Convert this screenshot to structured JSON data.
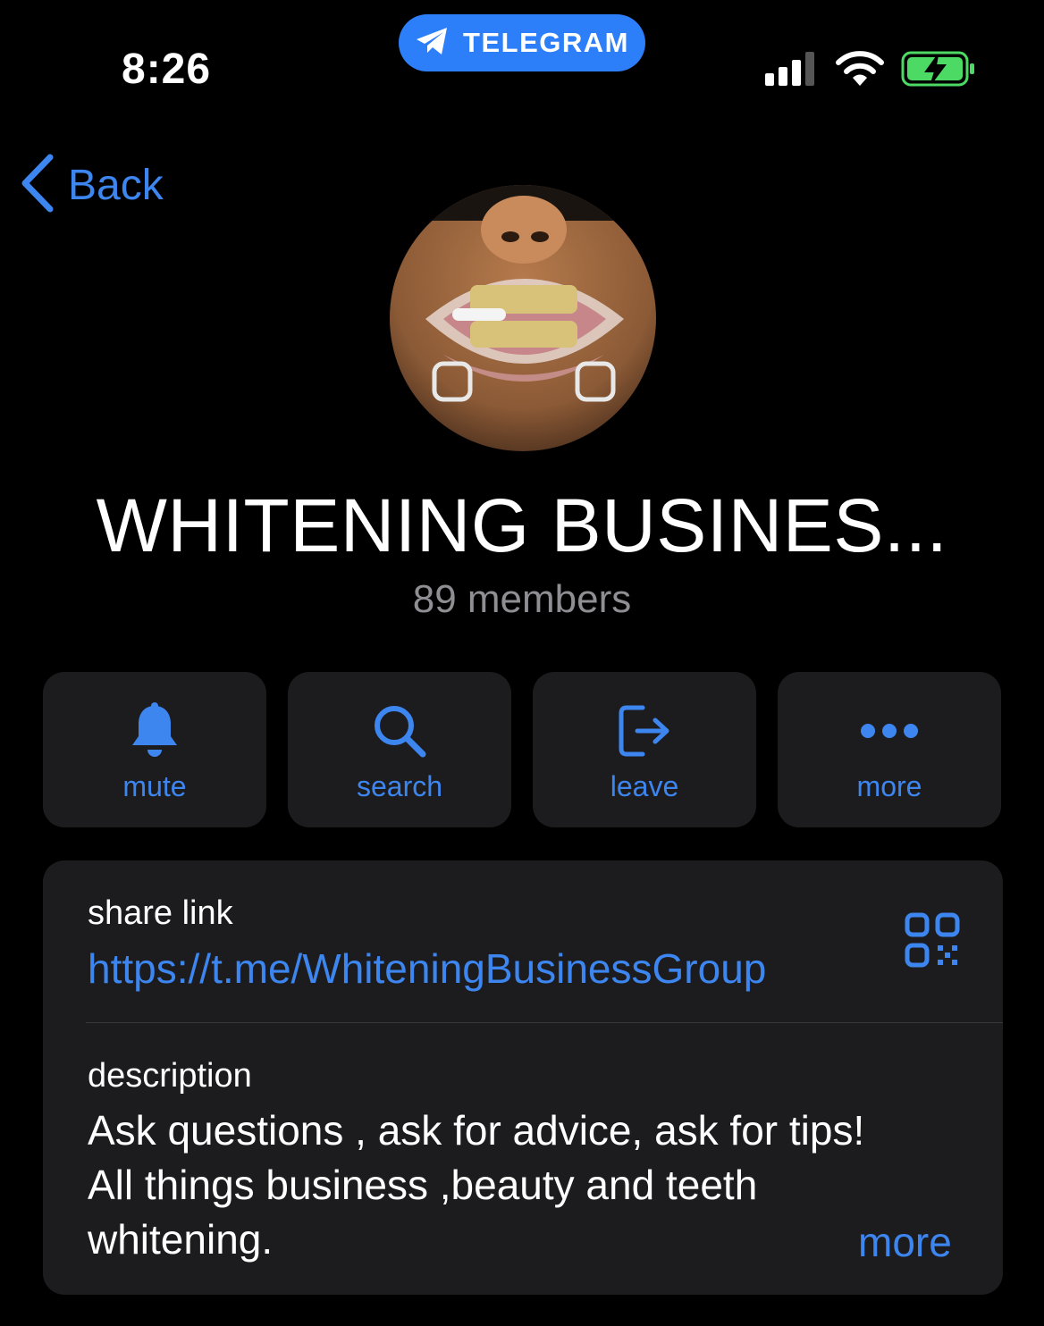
{
  "status_bar": {
    "time": "8:26",
    "return_app_label": "TELEGRAM"
  },
  "nav": {
    "back_label": "Back"
  },
  "group": {
    "title": "WHITENING BUSINES...",
    "members": "89 members"
  },
  "actions": [
    {
      "label": "mute",
      "icon": "bell-icon"
    },
    {
      "label": "search",
      "icon": "search-icon"
    },
    {
      "label": "leave",
      "icon": "leave-icon"
    },
    {
      "label": "more",
      "icon": "more-dots-icon"
    }
  ],
  "info": {
    "share_link_label": "share link",
    "share_link_url": "https://t.me/WhiteningBusinessGroup",
    "description_label": "description",
    "description_lines": [
      "Ask questions , ask for advice, ask for tips!",
      "All things business ,beauty and teeth",
      "whitening."
    ],
    "more_label": "more"
  },
  "colors": {
    "accent": "#3d86f0",
    "pill": "#2d7ff9",
    "card": "#1c1c1e",
    "secondary_text": "#8e8e93",
    "battery_fill": "#4cd964"
  }
}
